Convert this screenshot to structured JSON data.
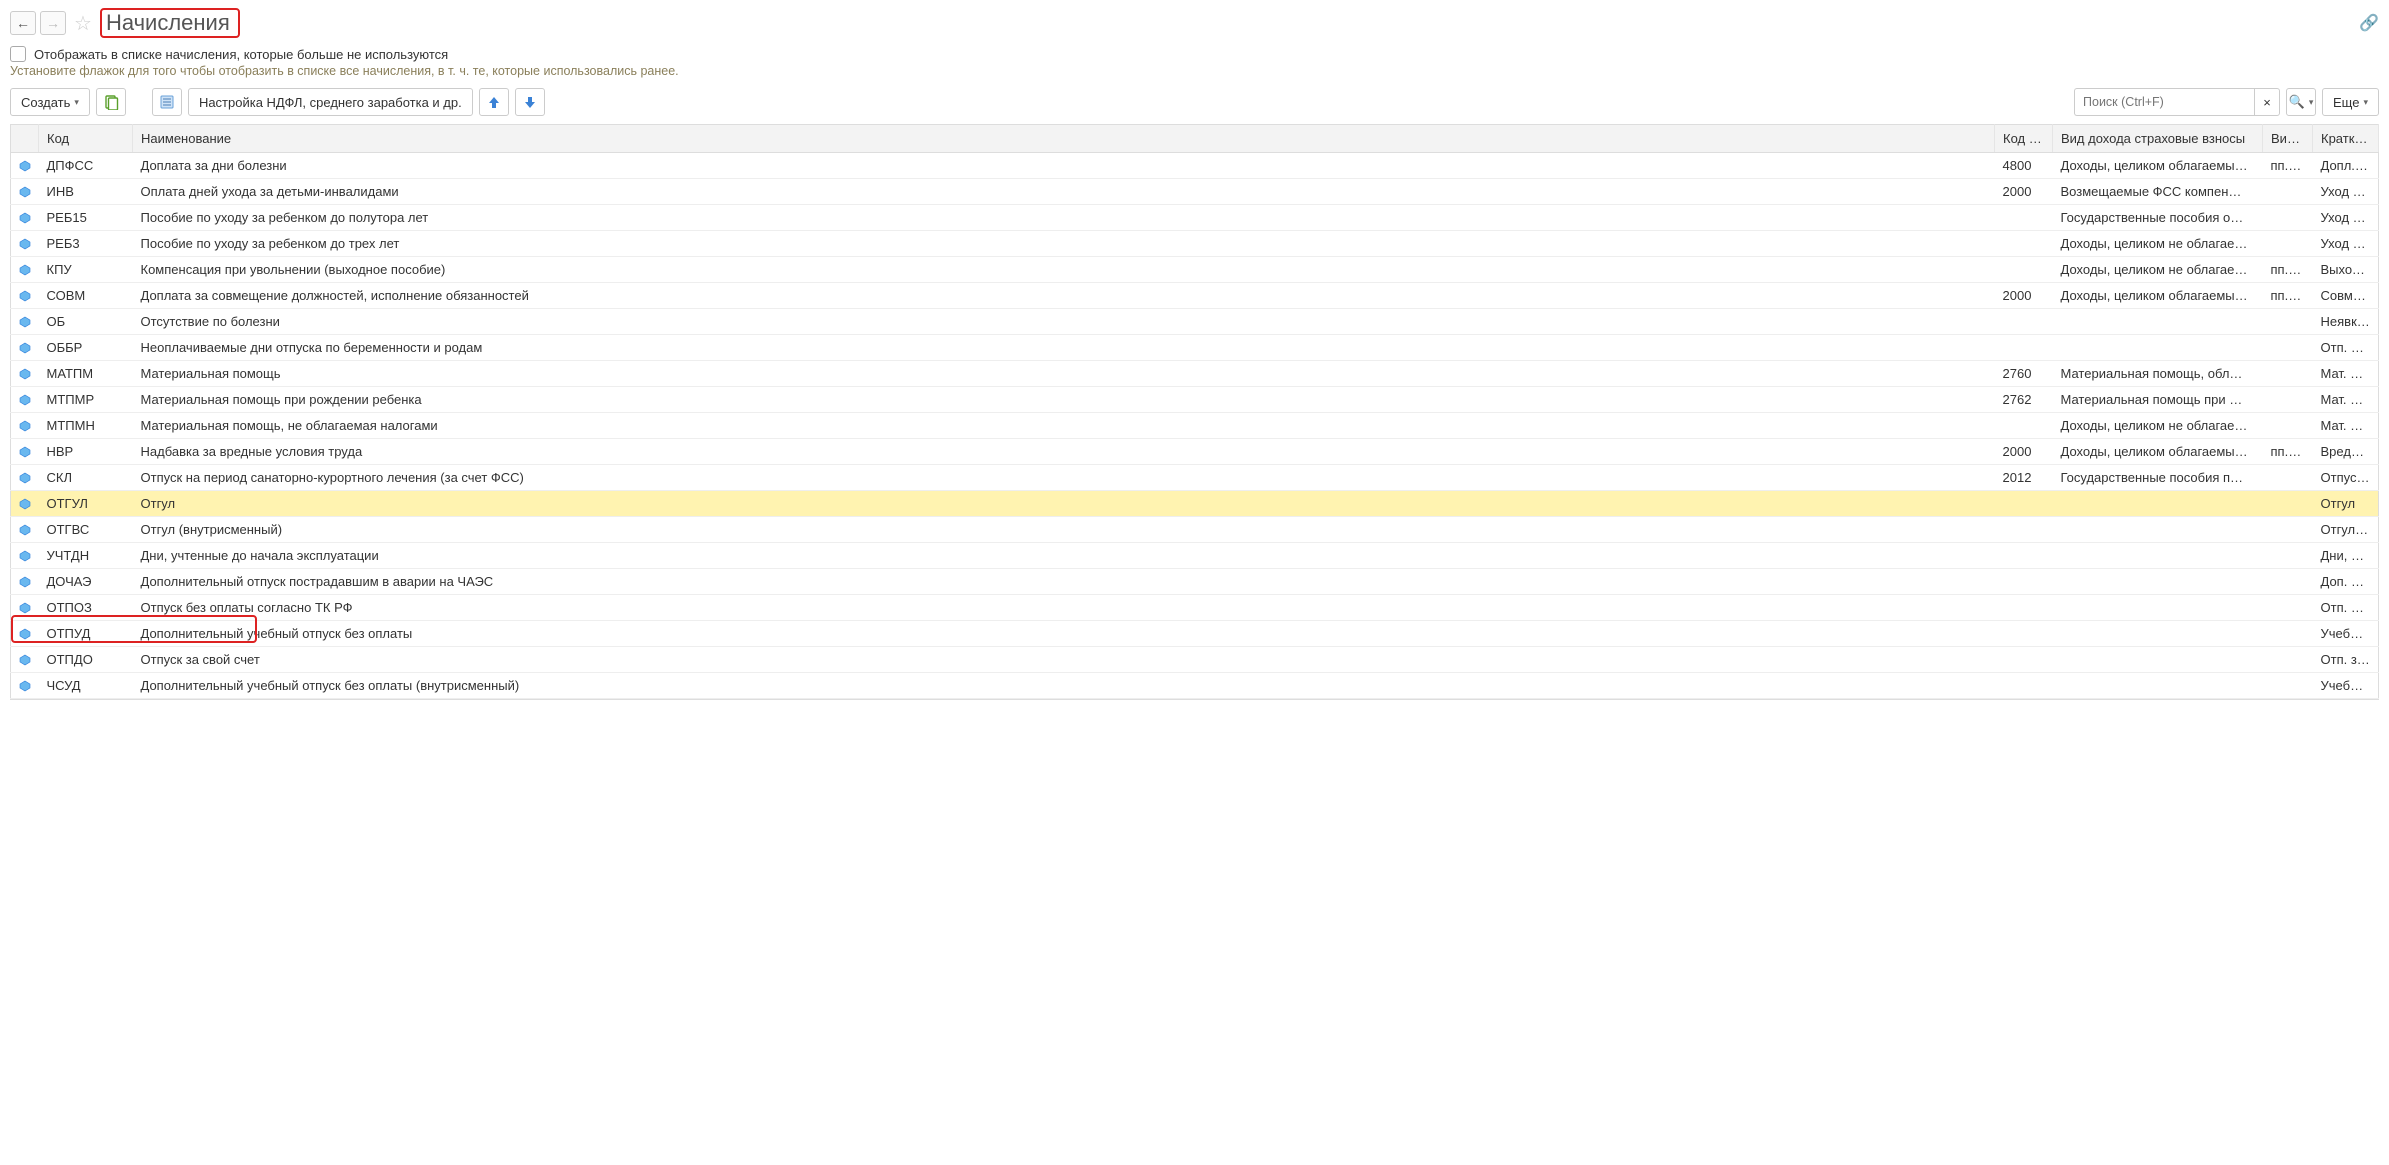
{
  "header": {
    "title": "Начисления"
  },
  "filter": {
    "checkbox_label": "Отображать в списке начисления, которые больше не используются",
    "hint": "Установите флажок для того чтобы отобразить в списке все начисления, в т. ч. те, которые использовались ранее."
  },
  "toolbar": {
    "create": "Создать",
    "ndfl": "Настройка НДФЛ, среднего заработка и др.",
    "search_placeholder": "Поиск (Ctrl+F)",
    "more": "Еще"
  },
  "columns": {
    "code": "Код",
    "name": "Наименование",
    "code_ndfl": "Код …",
    "income_type": "Вид дохода страховые взносы",
    "vid": "Вид…",
    "short": "Кратко…"
  },
  "rows": [
    {
      "code": "ДПФСС",
      "name": "Доплата за дни болезни",
      "code_ndfl": "4800",
      "income": "Доходы, целиком облагаемы…",
      "vid": "пп.…",
      "short": "Допл. …"
    },
    {
      "code": "ИНВ",
      "name": "Оплата дней ухода за детьми-инвалидами",
      "code_ndfl": "2000",
      "income": "Возмещаемые ФСС компен…",
      "vid": "",
      "short": "Уход з…"
    },
    {
      "code": "РЕБ15",
      "name": "Пособие по уходу за ребенком до полутора лет",
      "code_ndfl": "",
      "income": "Государственные пособия о…",
      "vid": "",
      "short": "Уход з…"
    },
    {
      "code": "РЕБ3",
      "name": "Пособие по уходу за ребенком до трех лет",
      "code_ndfl": "",
      "income": "Доходы, целиком не облагае…",
      "vid": "",
      "short": "Уход з…"
    },
    {
      "code": "КПУ",
      "name": "Компенсация при увольнении (выходное пособие)",
      "code_ndfl": "",
      "income": "Доходы, целиком не облагае…",
      "vid": "пп.…",
      "short": "Выход…"
    },
    {
      "code": "СОВМ",
      "name": "Доплата за совмещение должностей, исполнение обязанностей",
      "code_ndfl": "2000",
      "income": "Доходы, целиком облагаемы…",
      "vid": "пп.…",
      "short": "Совме…"
    },
    {
      "code": "ОБ",
      "name": "Отсутствие по болезни",
      "code_ndfl": "",
      "income": "",
      "vid": "",
      "short": "Неявк…"
    },
    {
      "code": "ОББР",
      "name": "Неоплачиваемые дни отпуска по беременности и родам",
      "code_ndfl": "",
      "income": "",
      "vid": "",
      "short": "Отп. п…"
    },
    {
      "code": "МАТПМ",
      "name": "Материальная помощь",
      "code_ndfl": "2760",
      "income": "Материальная помощь, обл…",
      "vid": "",
      "short": "Мат. п…"
    },
    {
      "code": "МТПМР",
      "name": "Материальная помощь при рождении ребенка",
      "code_ndfl": "2762",
      "income": "Материальная помощь при …",
      "vid": "",
      "short": "Мат. п…"
    },
    {
      "code": "МТПМН",
      "name": "Материальная помощь, не облагаемая налогами",
      "code_ndfl": "",
      "income": "Доходы, целиком не облагае…",
      "vid": "",
      "short": "Мат. п…"
    },
    {
      "code": "НВР",
      "name": "Надбавка за вредные условия труда",
      "code_ndfl": "2000",
      "income": "Доходы, целиком облагаемы…",
      "vid": "пп.…",
      "short": "Вредн…"
    },
    {
      "code": "СКЛ",
      "name": "Отпуск на период санаторно-курортного лечения (за счет ФСС)",
      "code_ndfl": "2012",
      "income": "Государственные пособия п…",
      "vid": "",
      "short": "Отпус…"
    },
    {
      "code": "ОТГУЛ",
      "name": "Отгул",
      "code_ndfl": "",
      "income": "",
      "vid": "",
      "short": "Отгул",
      "selected": true
    },
    {
      "code": "ОТГВС",
      "name": "Отгул (внутрисменный)",
      "code_ndfl": "",
      "income": "",
      "vid": "",
      "short": "Отгул …"
    },
    {
      "code": "УЧТДН",
      "name": "Дни, учтенные до начала эксплуатации",
      "code_ndfl": "",
      "income": "",
      "vid": "",
      "short": "Дни, у…"
    },
    {
      "code": "ДОЧАЭ",
      "name": "Дополнительный отпуск пострадавшим в аварии на ЧАЭС",
      "code_ndfl": "",
      "income": "",
      "vid": "",
      "short": "Доп. о…"
    },
    {
      "code": "ОТПОЗ",
      "name": "Отпуск без оплаты согласно ТК РФ",
      "code_ndfl": "",
      "income": "",
      "vid": "",
      "short": "Отп. б…"
    },
    {
      "code": "ОТПУД",
      "name": "Дополнительный учебный отпуск без оплаты",
      "code_ndfl": "",
      "income": "",
      "vid": "",
      "short": "Учебн…"
    },
    {
      "code": "ОТПДО",
      "name": "Отпуск за свой счет",
      "code_ndfl": "",
      "income": "",
      "vid": "",
      "short": "Отп. з…"
    },
    {
      "code": "ЧСУД",
      "name": "Дополнительный учебный отпуск без оплаты (внутрисменный)",
      "code_ndfl": "",
      "income": "",
      "vid": "",
      "short": "Учебн…"
    }
  ]
}
